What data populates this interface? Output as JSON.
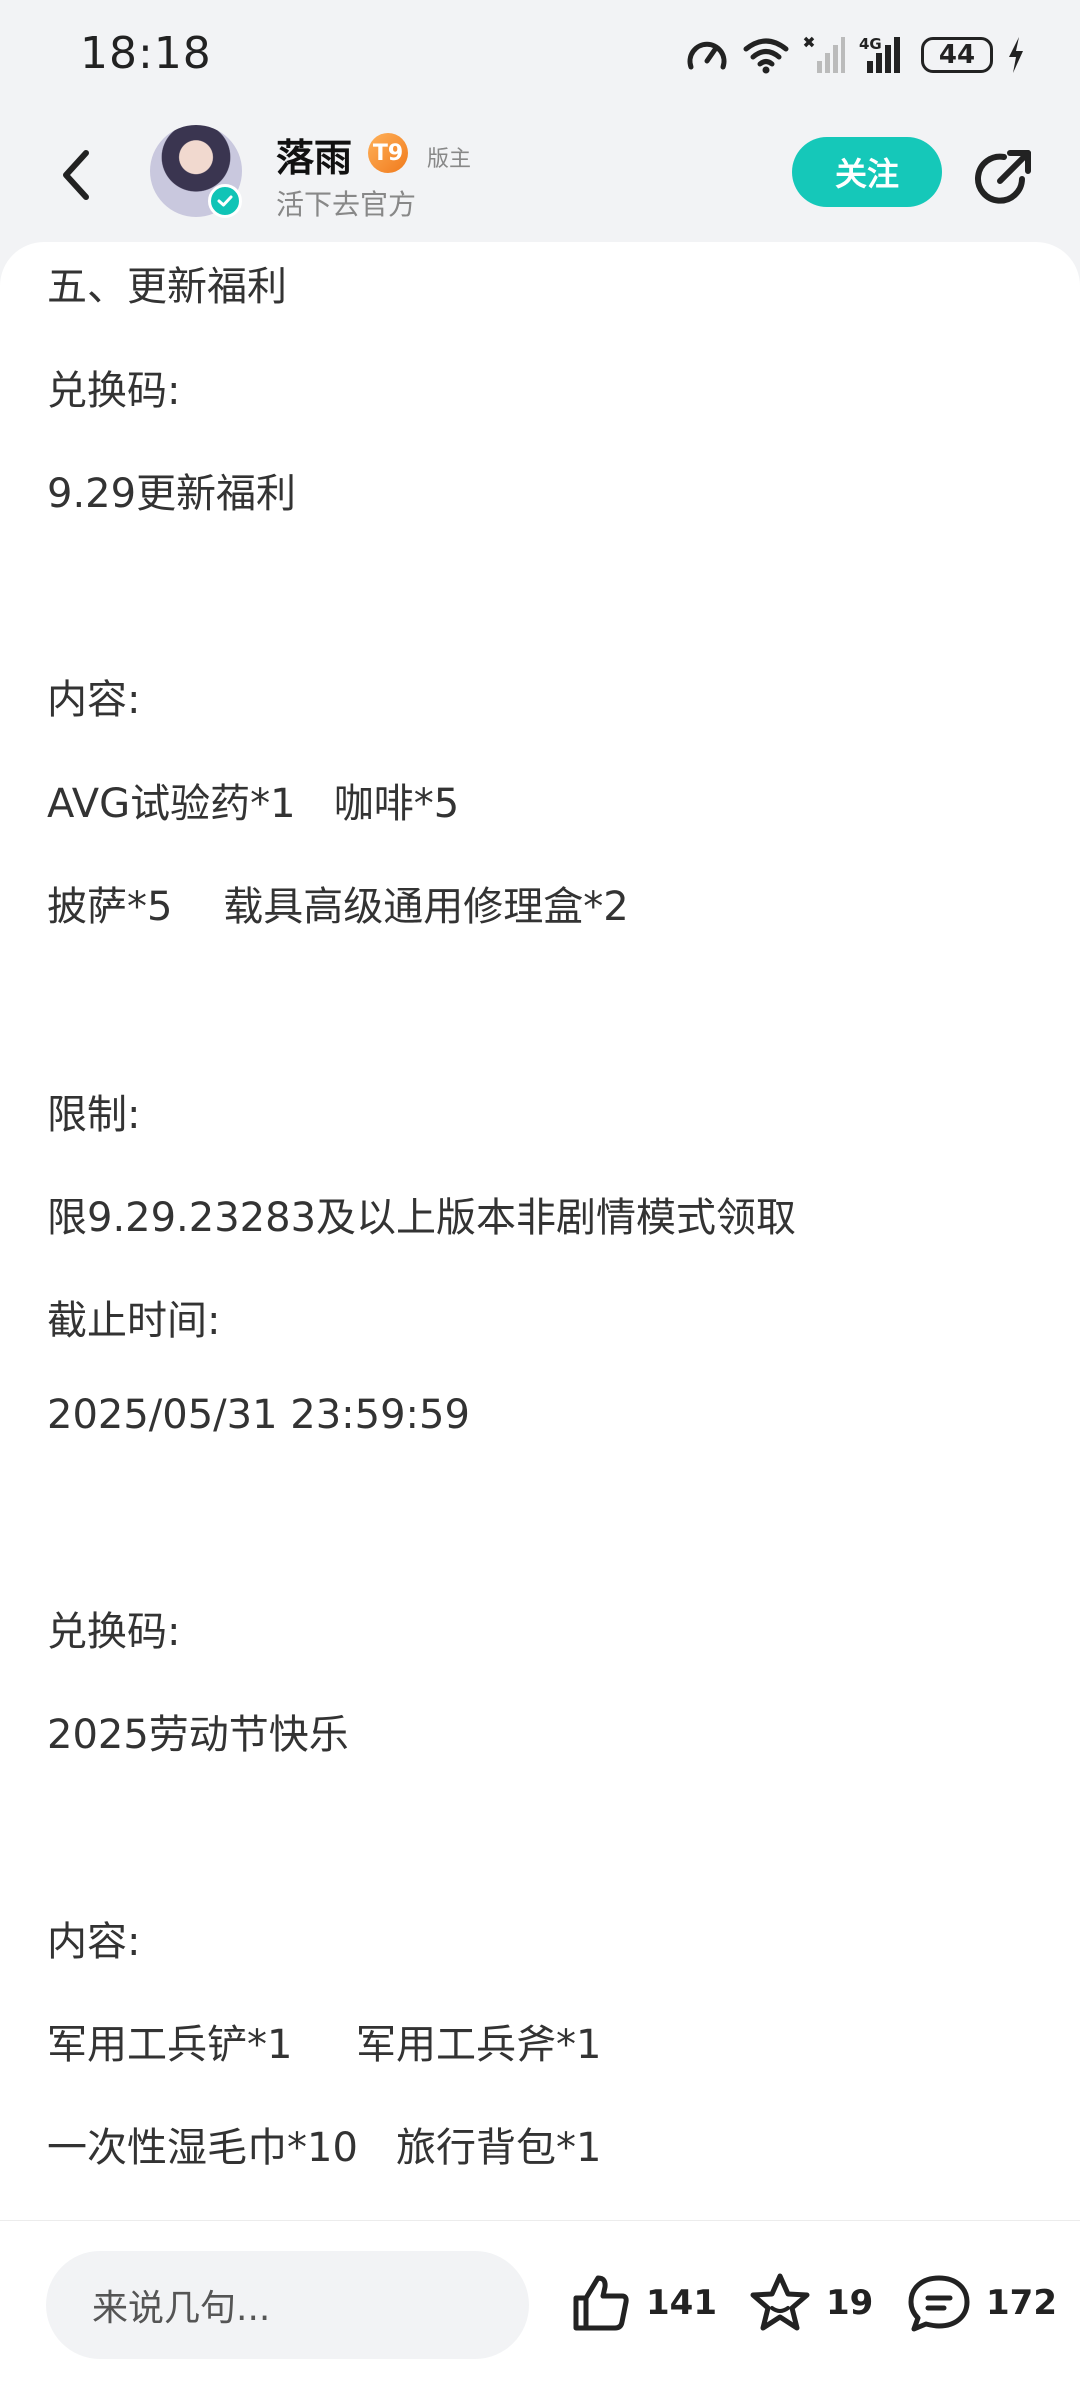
{
  "status_bar": {
    "time": "18:18",
    "battery": "44",
    "icons": [
      "speed-icon",
      "wifi-icon",
      "no-signal-icon",
      "signal-4g-icon",
      "battery-icon",
      "charging-icon"
    ]
  },
  "header": {
    "username": "落雨",
    "level": "T9",
    "role": "版主",
    "subtitle": "活下去官方",
    "follow_label": "关注",
    "icons": [
      "back-icon",
      "verified-icon",
      "share-icon"
    ]
  },
  "content": {
    "lines": [
      "五、更新福利",
      "兑换码:",
      "9.29更新福利",
      "",
      "内容:",
      "AVG试验药*1   咖啡*5",
      "披萨*5    载具高级通用修理盒*2",
      "",
      "限制:",
      "限9.29.23283及以上版本非剧情模式领取",
      "截止时间:",
      "2025/05/31 23:59:59",
      "",
      "兑换码:",
      "2025劳动节快乐",
      "",
      "内容:",
      "军用工兵铲*1     军用工兵斧*1",
      "一次性湿毛巾*10   旅行背包*1"
    ]
  },
  "bottom_bar": {
    "comment_placeholder": "来说几句...",
    "like_count": "141",
    "favorite_count": "19",
    "comment_count": "172",
    "icons": [
      "thumbs-up-icon",
      "star-icon",
      "comment-icon"
    ]
  },
  "colors": {
    "accent": "#15c8b9",
    "level_badge": "#f07a1c",
    "background": "#f2f3f5"
  }
}
